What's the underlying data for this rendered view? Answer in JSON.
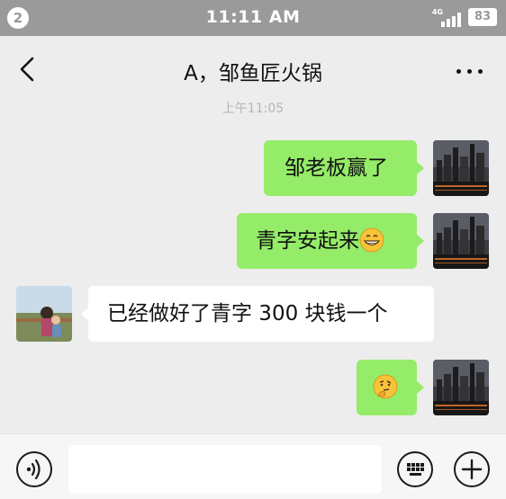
{
  "status_bar": {
    "notification_count": "2",
    "time": "11:11 AM",
    "network": "4G",
    "battery": "83"
  },
  "header": {
    "title": "A，邹鱼匠火锅",
    "back_icon": "chevron-left-icon",
    "more_icon": "ellipsis-icon"
  },
  "chat": {
    "timestamp": "上午11:05",
    "messages": [
      {
        "direction": "out",
        "text": "邹老板赢了"
      },
      {
        "direction": "out",
        "text": "青字安起来",
        "emoji": "grinning-face-emoji"
      },
      {
        "direction": "in",
        "text": "已经做好了青字 300 块钱一个"
      },
      {
        "direction": "out",
        "text": "",
        "emoji": "thinking-face-emoji"
      }
    ]
  },
  "input_bar": {
    "voice_icon": "voice-icon",
    "keyboard_icon": "keyboard-icon",
    "plus_icon": "plus-icon",
    "input_value": ""
  },
  "colors": {
    "outgoing_bubble": "#95ec69",
    "incoming_bubble": "#ffffff",
    "chat_background": "#ededed",
    "status_bar": "#9a9a9a"
  }
}
